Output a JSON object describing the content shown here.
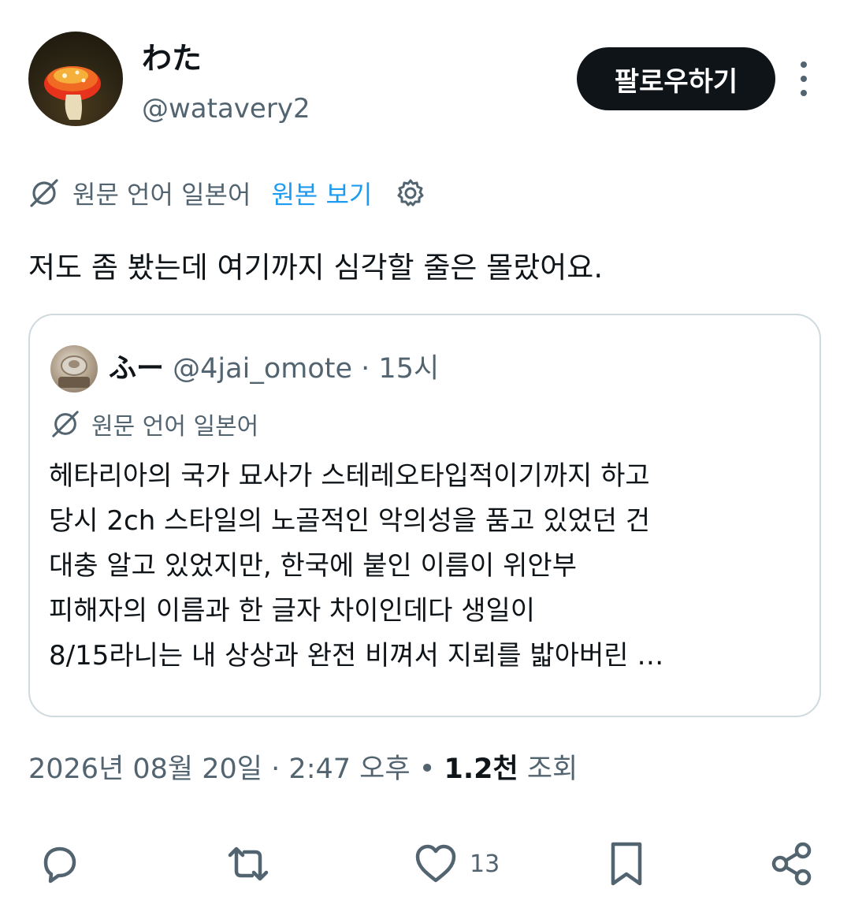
{
  "author": {
    "display_name": "わた",
    "handle": "@watavery2"
  },
  "header": {
    "follow_label": "팔로우하기"
  },
  "translation": {
    "source_language_label": "원문 언어 일본어",
    "view_original_label": "원본 보기"
  },
  "tweet": {
    "text": "저도 좀 봤는데 여기까지 심각할 줄은 몰랐어요."
  },
  "quoted_tweet": {
    "display_name": "ふー",
    "handle": "@4jai_omote",
    "separator": "·",
    "time": "15시",
    "source_language_label": "원문 언어 일본어",
    "text_lines": [
      "헤타리아의 국가 묘사가 스테레오타입적이기까지 하고",
      "당시 2ch 스타일의 노골적인 악의성을 품고 있었던 건",
      "대충 알고 있었지만, 한국에 붙인 이름이 위안부",
      "피해자의 이름과 한 글자 차이인데다 생일이",
      "8/15라니는 내 상상과 완전 비껴서 지뢰를 밟아버린 …"
    ]
  },
  "meta": {
    "date": "2026년 08월 20일",
    "separator": "·",
    "time": "2:47 오후",
    "bullet": "•",
    "views_count": "1.2천",
    "views_label": "조회"
  },
  "actions": {
    "like_count": "13"
  },
  "icons": {
    "translate": "globe-slash-icon",
    "settings": "gear-icon",
    "more": "more-vertical-icon",
    "reply": "reply-icon",
    "retweet": "retweet-icon",
    "like": "heart-icon",
    "bookmark": "bookmark-icon",
    "share": "share-icon"
  },
  "colors": {
    "text_primary": "#0f1419",
    "text_secondary": "#536471",
    "accent": "#1d9bf0",
    "border": "#cfd9de",
    "button_bg": "#0f1419"
  }
}
